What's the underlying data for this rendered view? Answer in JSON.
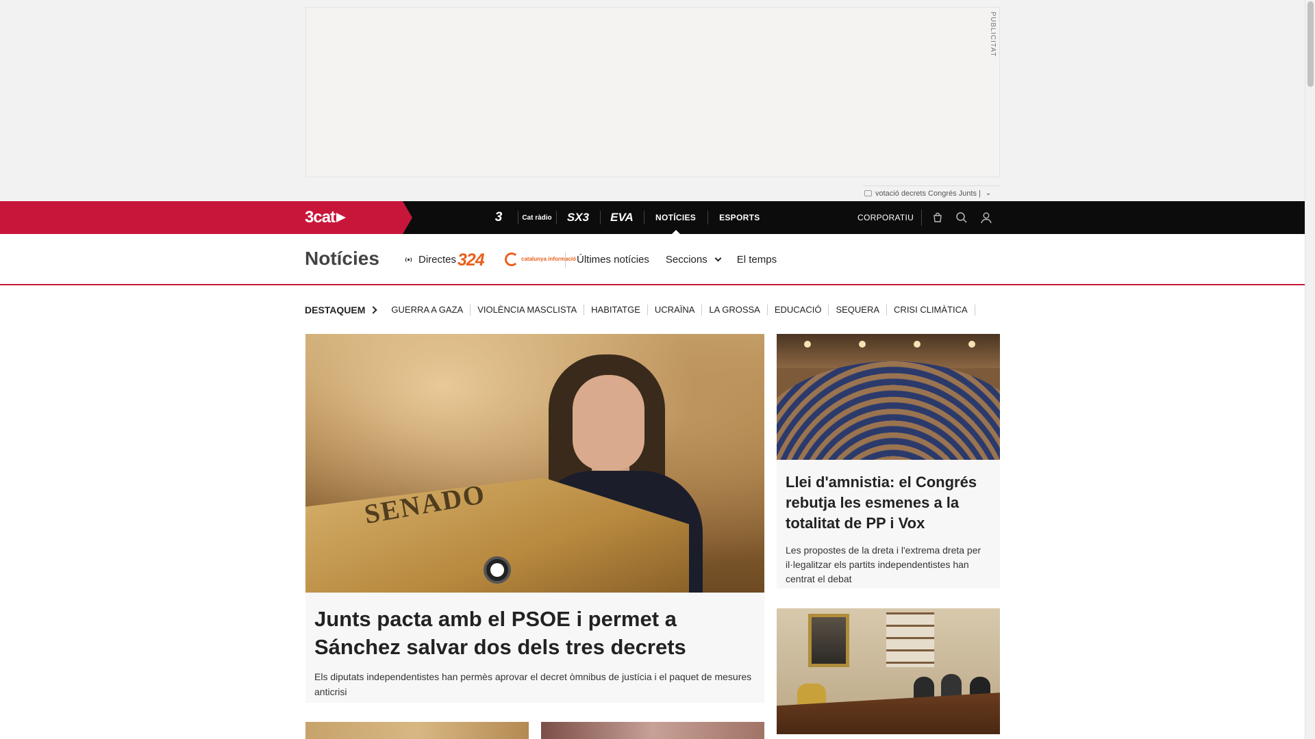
{
  "ad": {
    "label": "PUBLICITAT",
    "trending_text": "votació decrets Congrés Junts |"
  },
  "topbar": {
    "brand": "3cat",
    "channels": [
      {
        "label": "3",
        "icon": "tv3-logo"
      },
      {
        "label": "Cat ràdio",
        "icon": "catradio-logo"
      },
      {
        "label": "SX3",
        "icon": "sx3-logo"
      },
      {
        "label": "EVA",
        "icon": "eva-logo"
      }
    ],
    "noticies": "NOTÍCIES",
    "esports": "ESPORTS",
    "corporatiu": "CORPORATIU",
    "icons": [
      "shopping-bag-icon",
      "search-icon",
      "user-icon"
    ]
  },
  "section": {
    "title": "Notícies",
    "directes": "Directes",
    "logo_324": "324",
    "logo_ci": "catalunya informació",
    "nav": [
      "Últimes notícies",
      "Seccions",
      "El temps"
    ]
  },
  "topics": {
    "lead": "DESTAQUEM",
    "items": [
      "GUERRA A GAZA",
      "VIOLÈNCIA MASCLISTA",
      "HABITATGE",
      "UCRAÏNA",
      "LA GROSSA",
      "EDUCACIÓ",
      "SEQUERA",
      "CRISI CLIMÀTICA"
    ]
  },
  "main_article": {
    "image_text": "SENADO",
    "title": "Junts pacta amb el PSOE i permet a Sánchez salvar dos dels tres decrets",
    "lead": "Els diputats independentistes han permès aprovar el decret òmnibus de justícia i el paquet de mesures anticrisi"
  },
  "side_article": {
    "title": "Llei d'amnistia: el Congrés rebutja les esmenes a la totalitat de PP i Vox",
    "lead": "Les propostes de la dreta i l'extrema dreta per il·legalitzar els partits independentistes han centrat el debat"
  },
  "colors": {
    "brand_red": "#c8163b",
    "topbar_bg": "#0c0c0c",
    "accent_orange": "#e8601c"
  }
}
